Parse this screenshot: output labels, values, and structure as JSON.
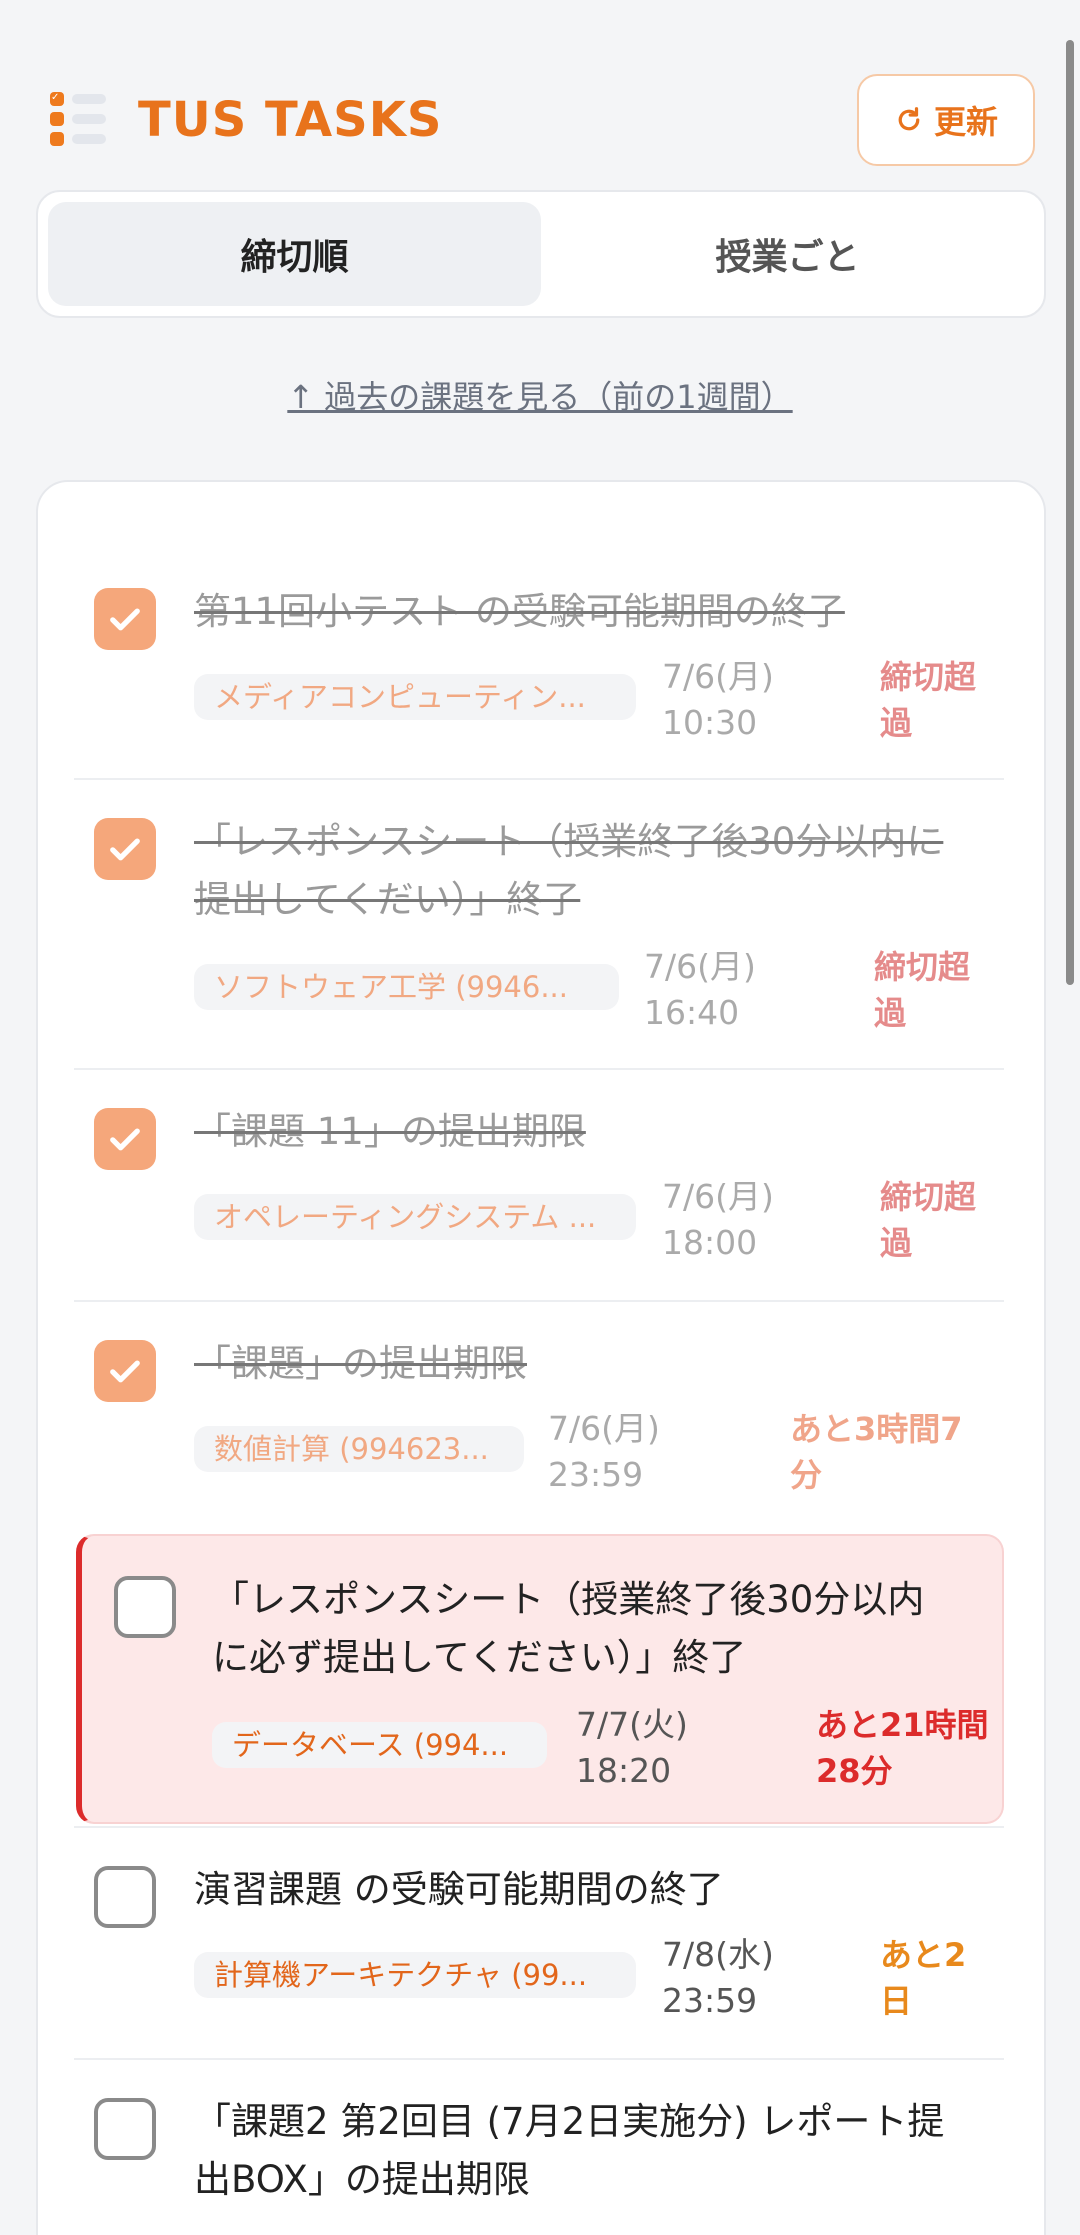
{
  "app": {
    "title": "TUS TASKS",
    "refresh_label": "更新"
  },
  "tabs": [
    {
      "label": "締切順",
      "active": true
    },
    {
      "label": "授業ごと",
      "active": false
    }
  ],
  "past_link": "↑ 過去の課題を見る（前の1週間）",
  "tasks": [
    {
      "done": true,
      "title": "第11回小テスト の受験可能期間の終了",
      "course": "メディアコンピューティン...",
      "date": "7/6(月)",
      "time": "10:30",
      "status": "締切超過"
    },
    {
      "done": true,
      "title_line1": "「レスポンスシート（授業終了後30分以内に",
      "title_line2": "提出してくだい）」終了",
      "course": "ソフトウェア工学 (9946...",
      "date": "7/6(月)",
      "time": "16:40",
      "status": "締切超過"
    },
    {
      "done": true,
      "title": "「課題 11」の提出期限",
      "course": "オペレーティングシステム ...",
      "date": "7/6(月)",
      "time": "18:00",
      "status": "締切超過"
    },
    {
      "done": true,
      "title": "「課題」の提出期限",
      "course": "数値計算 (994623...",
      "date": "7/6(月)",
      "time": "23:59",
      "status": "あと3時間7分"
    },
    {
      "done": false,
      "urgent": true,
      "title_line1": "「レスポンスシート（授業終了後30分以内",
      "title_line2": "に必ず提出してください）」終了",
      "course": "データベース (994...",
      "date": "7/7(火)",
      "time": "18:20",
      "status": "あと21時間28分"
    },
    {
      "done": false,
      "title": "演習課題 の受験可能期間の終了",
      "course": "計算機アーキテクチャ (99...",
      "date": "7/8(水)",
      "time": "23:59",
      "status": "あと2日"
    },
    {
      "done": false,
      "title_line1": "「課題2 第2回目 (7月2日実施分) レポート提",
      "title_line2": "出BOX」の提出期限"
    }
  ],
  "colors": {
    "accent": "#e8731c",
    "checked": "#f5a77b",
    "urgent": "#dc2b2b",
    "urgent_bg": "#fde8e8"
  }
}
